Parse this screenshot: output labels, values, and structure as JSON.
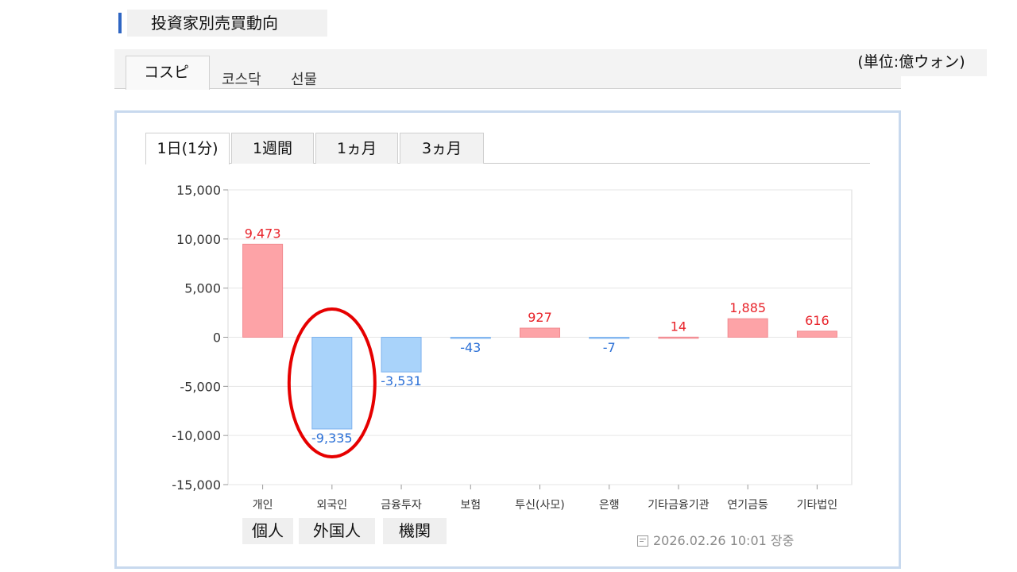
{
  "header": {
    "title": "投資家別売買動向",
    "unit": "(単位:億ウォン)"
  },
  "market_tabs": [
    {
      "label": "コスピ",
      "active": true
    },
    {
      "label": "코스닥",
      "active": false
    },
    {
      "label": "선물",
      "active": false
    }
  ],
  "period_tabs": [
    {
      "label": "1日(1分)",
      "active": true
    },
    {
      "label": "1週間",
      "active": false
    },
    {
      "label": "1ヵ月",
      "active": false
    },
    {
      "label": "3ヵ月",
      "active": false
    }
  ],
  "japanese_labels": [
    "個人",
    "外国人",
    "機関"
  ],
  "timestamp": "2026.02.26 10:01 장중",
  "colors": {
    "positive": "#e8232a",
    "negative": "#2a6fd6",
    "positive_fill": "#fda3a7",
    "negative_fill": "#a9d3fa",
    "highlight": "#e60000"
  },
  "icons": {
    "timestamp": "calendar-icon"
  },
  "highlight": {
    "category": "외국인",
    "shape": "red ellipse"
  },
  "chart_data": {
    "type": "bar",
    "categories": [
      "개인",
      "외국인",
      "금융투자",
      "보험",
      "투신(사모)",
      "은행",
      "기타금융기관",
      "연기금등",
      "기타법인"
    ],
    "values": [
      9473,
      -9335,
      -3531,
      -43,
      927,
      -7,
      14,
      1885,
      616
    ],
    "value_labels": [
      "9,473",
      "-9,335",
      "-3,531",
      "-43",
      "927",
      "-7",
      "14",
      "1,885",
      "616"
    ],
    "yticks": [
      15000,
      10000,
      5000,
      0,
      -5000,
      -10000,
      -15000
    ],
    "ytick_labels": [
      "15,000",
      "10,000",
      "5,000",
      "0",
      "-5,000",
      "-10,000",
      "-15,000"
    ],
    "ylim": [
      -15000,
      15000
    ],
    "title": "",
    "xlabel": "",
    "ylabel": "",
    "grid": true
  }
}
